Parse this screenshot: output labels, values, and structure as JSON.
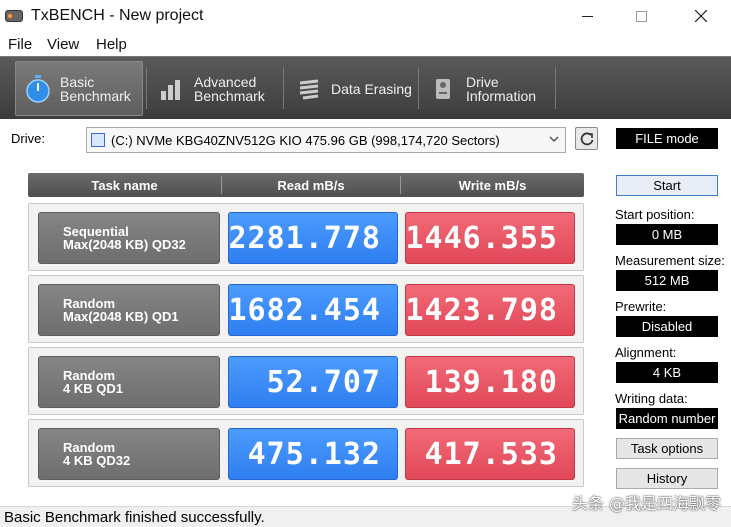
{
  "window": {
    "title": "TxBENCH - New project"
  },
  "menu": {
    "items": [
      "File",
      "View",
      "Help"
    ]
  },
  "toolbar": {
    "tabs": [
      {
        "label": "Basic\nBenchmark",
        "icon": "stopwatch-icon",
        "active": true
      },
      {
        "label": "Advanced\nBenchmark",
        "icon": "bar-chart-icon",
        "active": false
      },
      {
        "label": "Data Erasing",
        "icon": "eraser-icon",
        "active": false
      },
      {
        "label": "Drive\nInformation",
        "icon": "drive-info-icon",
        "active": false
      }
    ]
  },
  "drive": {
    "label": "Drive:",
    "selected": "(C:) NVMe KBG40ZNV512G KIO  475.96 GB (998,174,720 Sectors)",
    "mode": "FILE mode"
  },
  "results": {
    "headers": [
      "Task name",
      "Read mB/s",
      "Write mB/s"
    ],
    "rows": [
      {
        "name1": "Sequential",
        "name2": "Max(2048 KB) QD32",
        "read": "2281.778",
        "write": "1446.355"
      },
      {
        "name1": "Random",
        "name2": "Max(2048 KB) QD1",
        "read": "1682.454",
        "write": "1423.798"
      },
      {
        "name1": "Random",
        "name2": "4 KB QD1",
        "read": "52.707",
        "write": "139.180"
      },
      {
        "name1": "Random",
        "name2": "4 KB QD32",
        "read": "475.132",
        "write": "417.533"
      }
    ]
  },
  "side": {
    "start": "Start",
    "start_position_label": "Start position:",
    "start_position": "0 MB",
    "measurement_label": "Measurement size:",
    "measurement": "512 MB",
    "prewrite_label": "Prewrite:",
    "prewrite": "Disabled",
    "alignment_label": "Alignment:",
    "alignment": "4 KB",
    "writing_label": "Writing data:",
    "writing": "Random number",
    "task_options": "Task options",
    "history": "History"
  },
  "status": {
    "text": "Basic Benchmark finished successfully."
  },
  "watermark": "头条 @我是四海飘零",
  "colors": {
    "read": "#3a8cf8",
    "write": "#e85565",
    "toolbar": "#4a4a4a"
  }
}
